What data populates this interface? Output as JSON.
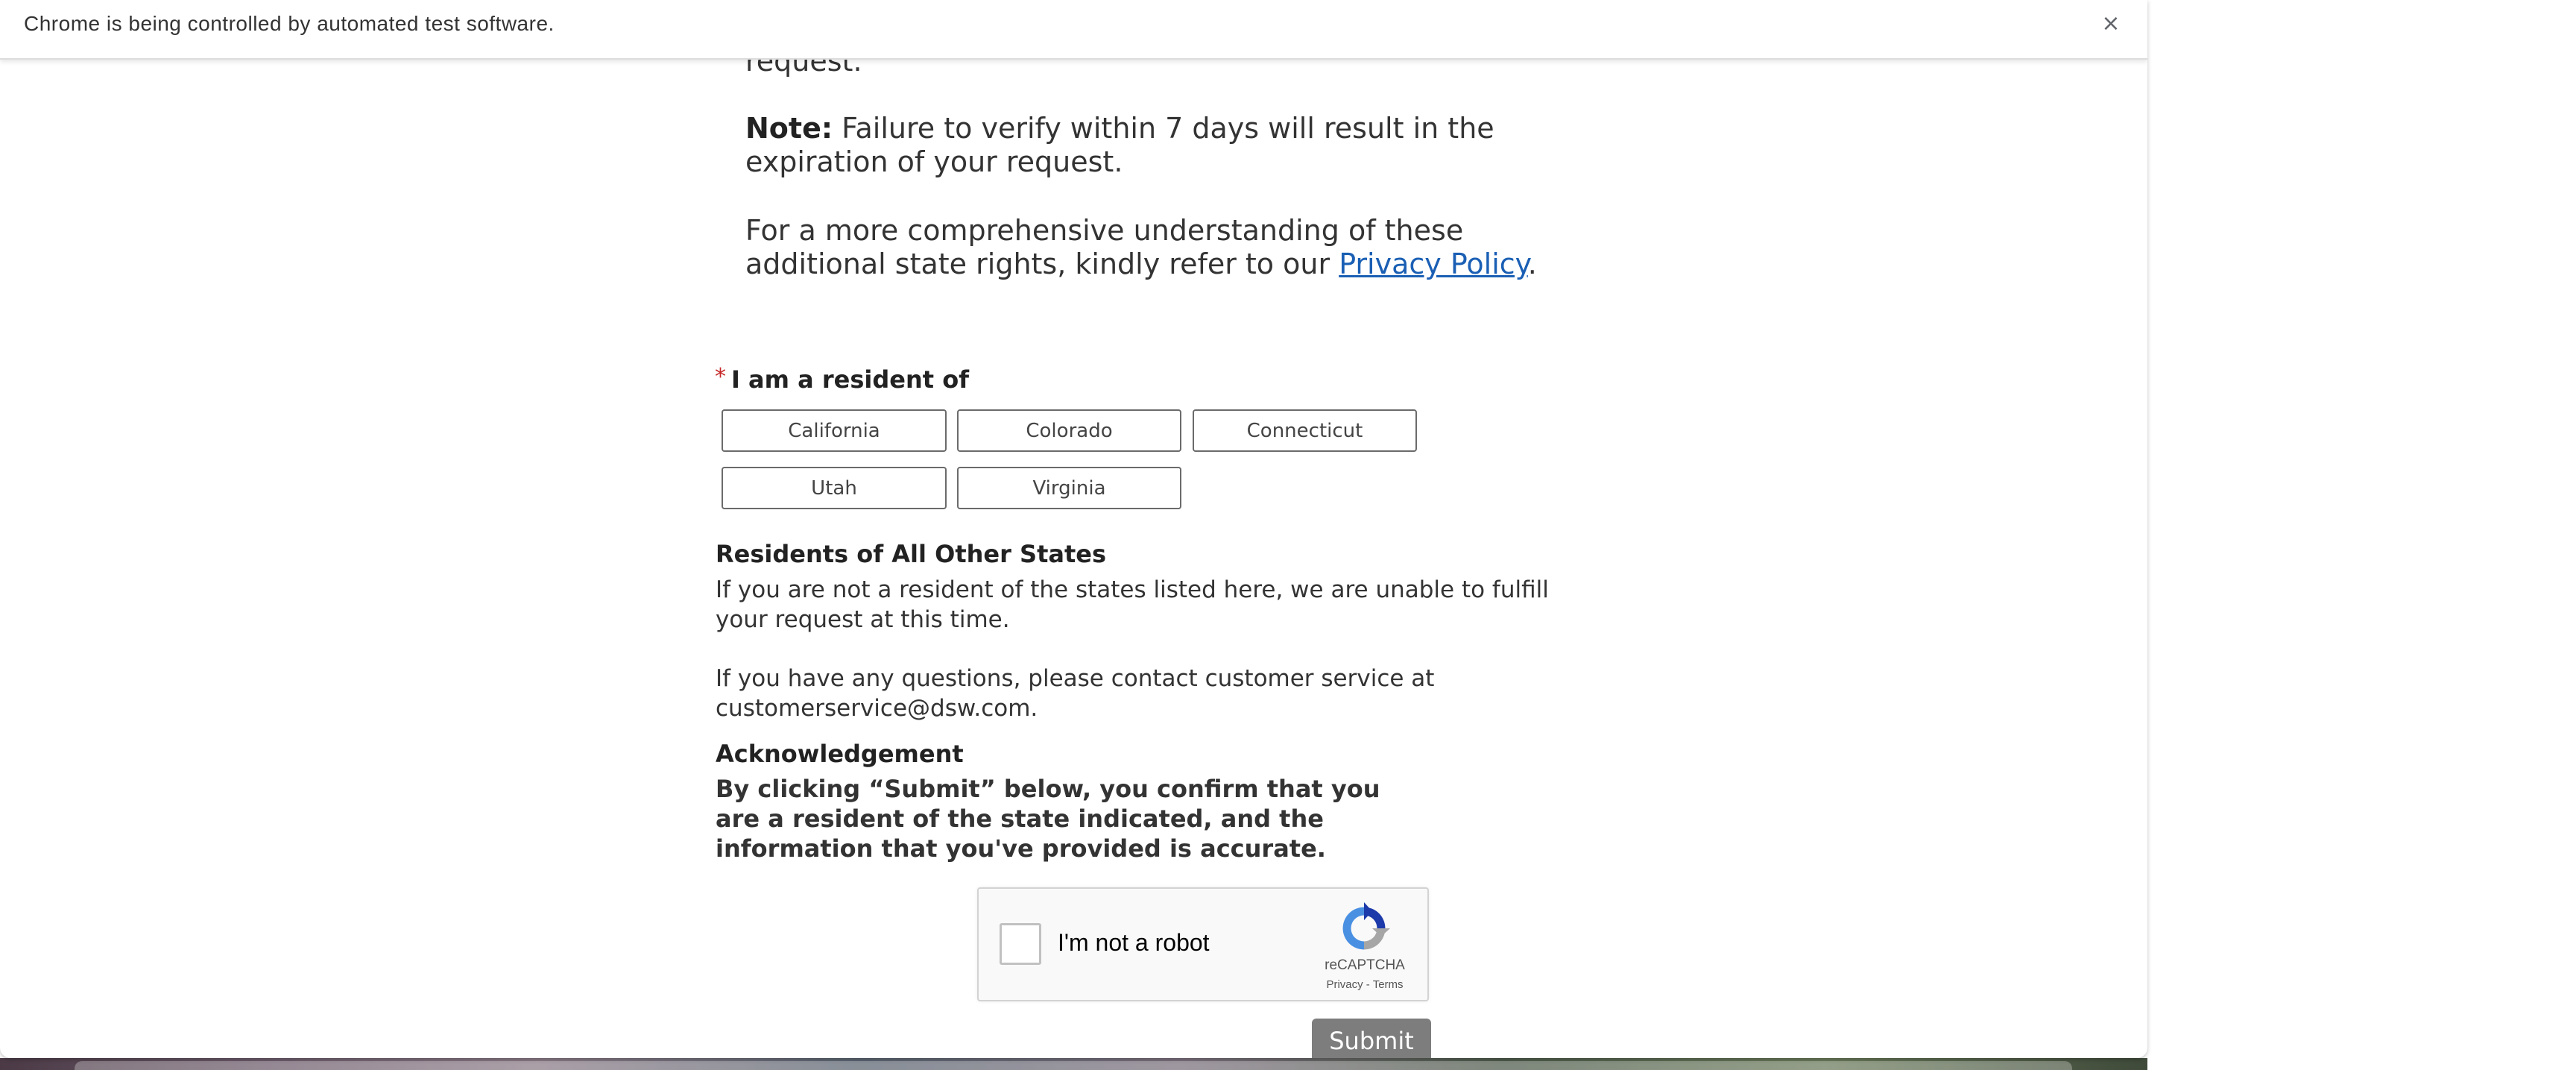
{
  "infobar": {
    "message": "Chrome is being controlled by automated test software.",
    "close_glyph": "×"
  },
  "page": {
    "request_fragment": "request.",
    "note_label": "Note:",
    "note_line1": "Failure to verify within 7 days will result in the",
    "note_line2": "expiration of your request.",
    "privacy_line1": "For a more comprehensive understanding of these",
    "privacy_line2": "additional state rights, kindly refer to our",
    "privacy_link": "Privacy Policy",
    "privacy_period": "."
  },
  "residency": {
    "required_marker": "*",
    "question": "I am a resident of",
    "states": [
      "California",
      "Colorado",
      "Connecticut",
      "Utah",
      "Virginia"
    ]
  },
  "other_states": {
    "heading": "Residents of All Other States",
    "line1": "If you are not a resident of the states listed here, we are unable to fulfill",
    "line2": "your request at this time.",
    "contact_line1": "If you have any questions, please contact customer service at",
    "contact_line2": "customerservice@dsw.com."
  },
  "acknowledgement": {
    "heading": "Acknowledgement",
    "text": "By clicking “Submit” below, you confirm that you are a resident of the state indicated, and the information that you've provided is accurate."
  },
  "recaptcha": {
    "label": "I'm not a robot",
    "brand": "reCAPTCHA",
    "privacy": "Privacy",
    "separator": " - ",
    "terms": "Terms",
    "accent_color": "#4a90e2"
  },
  "form": {
    "submit_label": "Submit",
    "submit_color": "#7d7d7d"
  }
}
